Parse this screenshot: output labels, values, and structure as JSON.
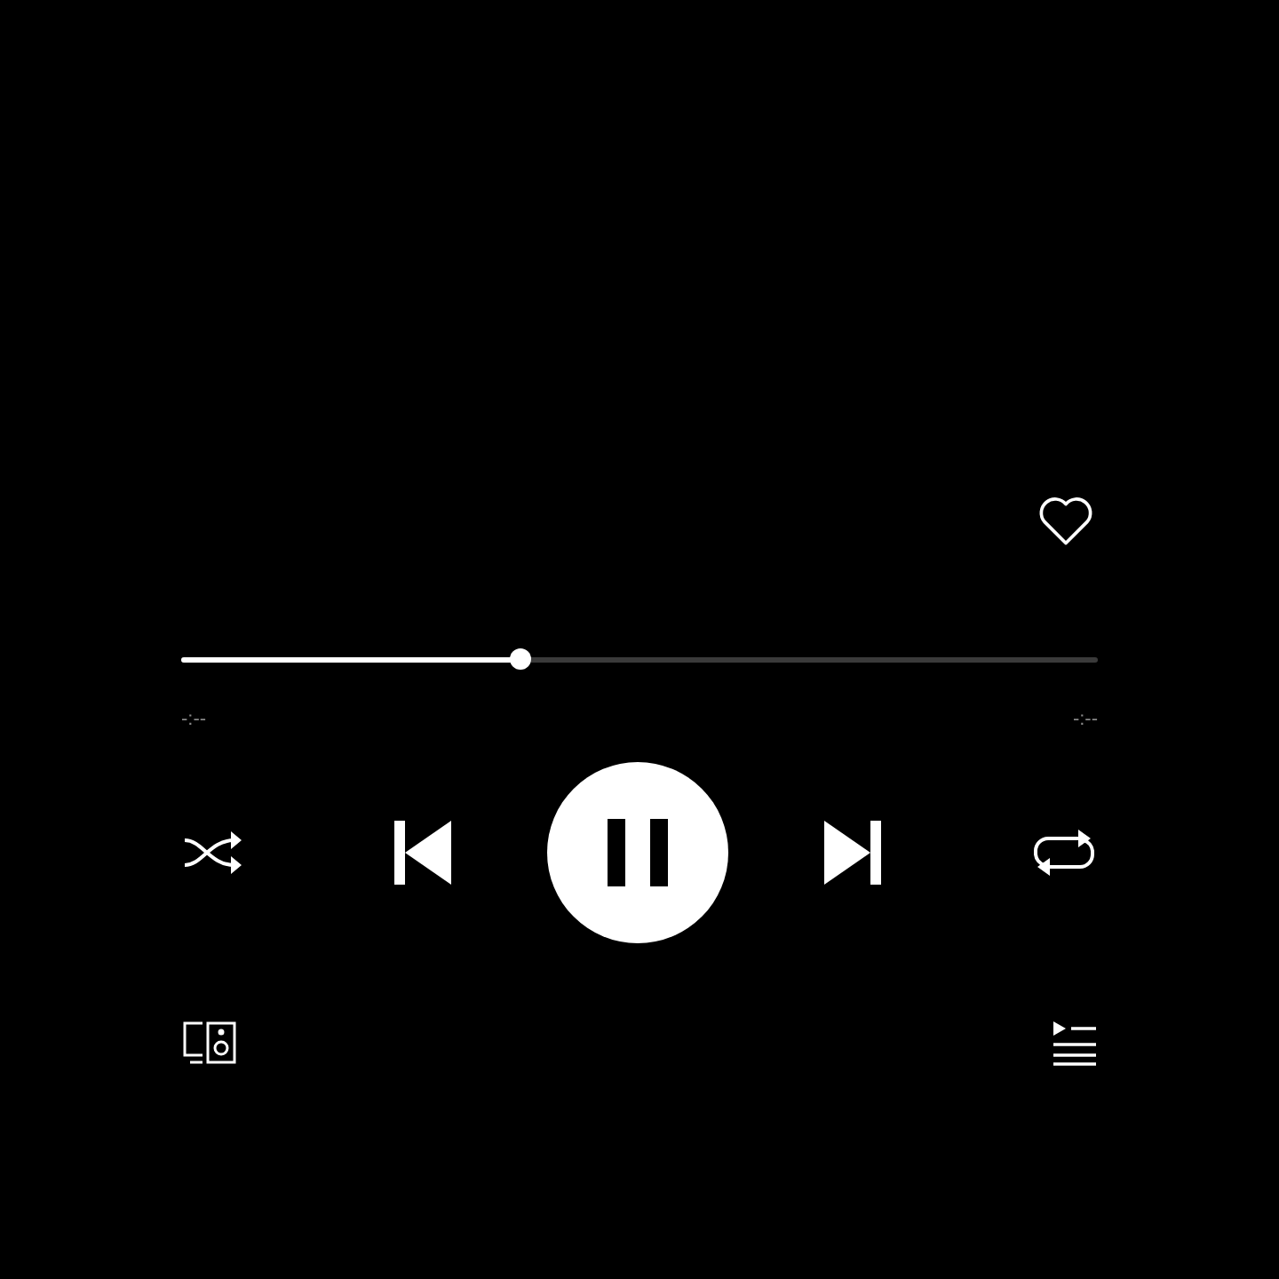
{
  "liked": false,
  "progress": {
    "level": 0.37,
    "elapsed": "-:--",
    "remaining": "-:--"
  },
  "playing": true
}
